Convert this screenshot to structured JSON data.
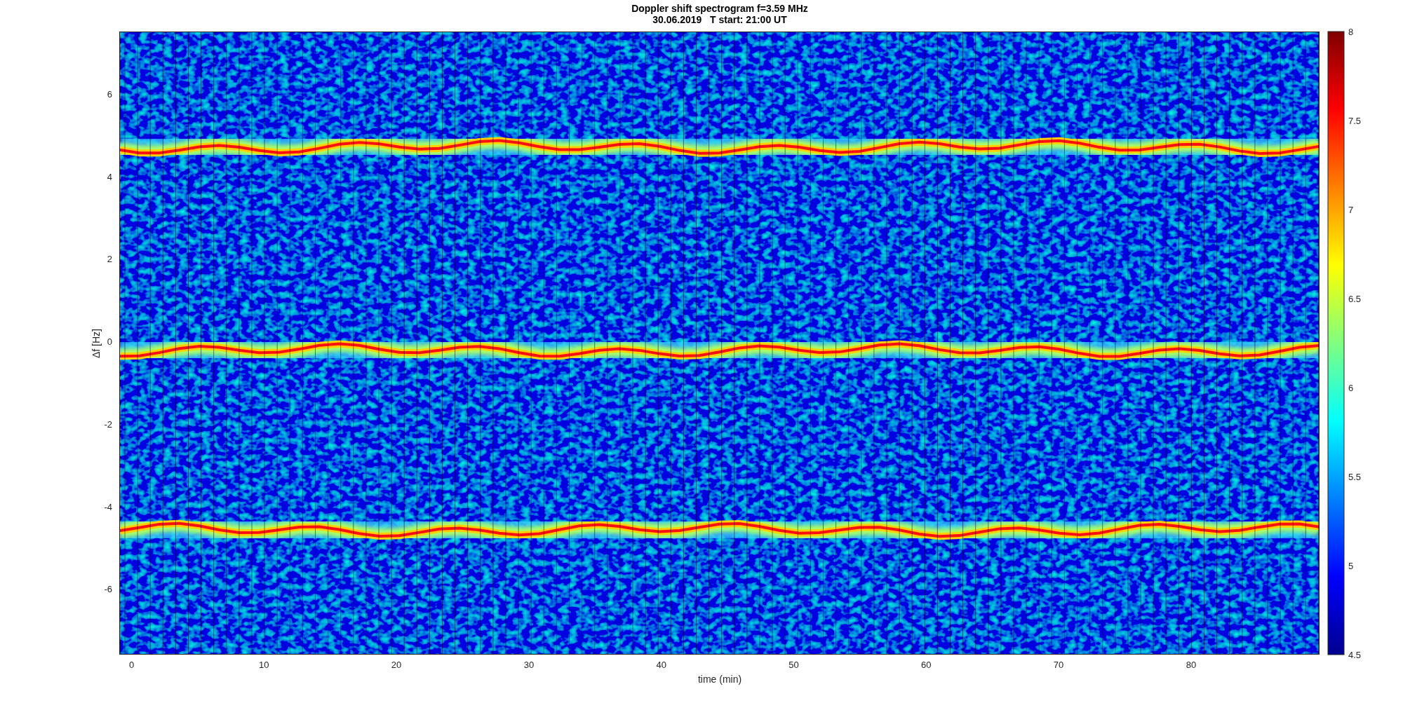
{
  "figure": {
    "title_lines": [
      "Doppler shift spectrogram f=3.59 MHz",
      "30.06.2019   T start: 21:00 UT"
    ],
    "axes": {
      "xlabel": "time (min)",
      "ylabel": "Δf [Hz]",
      "xticks": [
        "0",
        "10",
        "20",
        "30",
        "40",
        "50",
        "60",
        "70",
        "80"
      ],
      "yticks": [
        "6",
        "4",
        "2",
        "0",
        "-2",
        "-4",
        "-6"
      ]
    },
    "colorbar": {
      "ticks": [
        "8",
        "7.5",
        "7",
        "6.5",
        "6",
        "5.5",
        "5",
        "4.5"
      ]
    }
  }
}
